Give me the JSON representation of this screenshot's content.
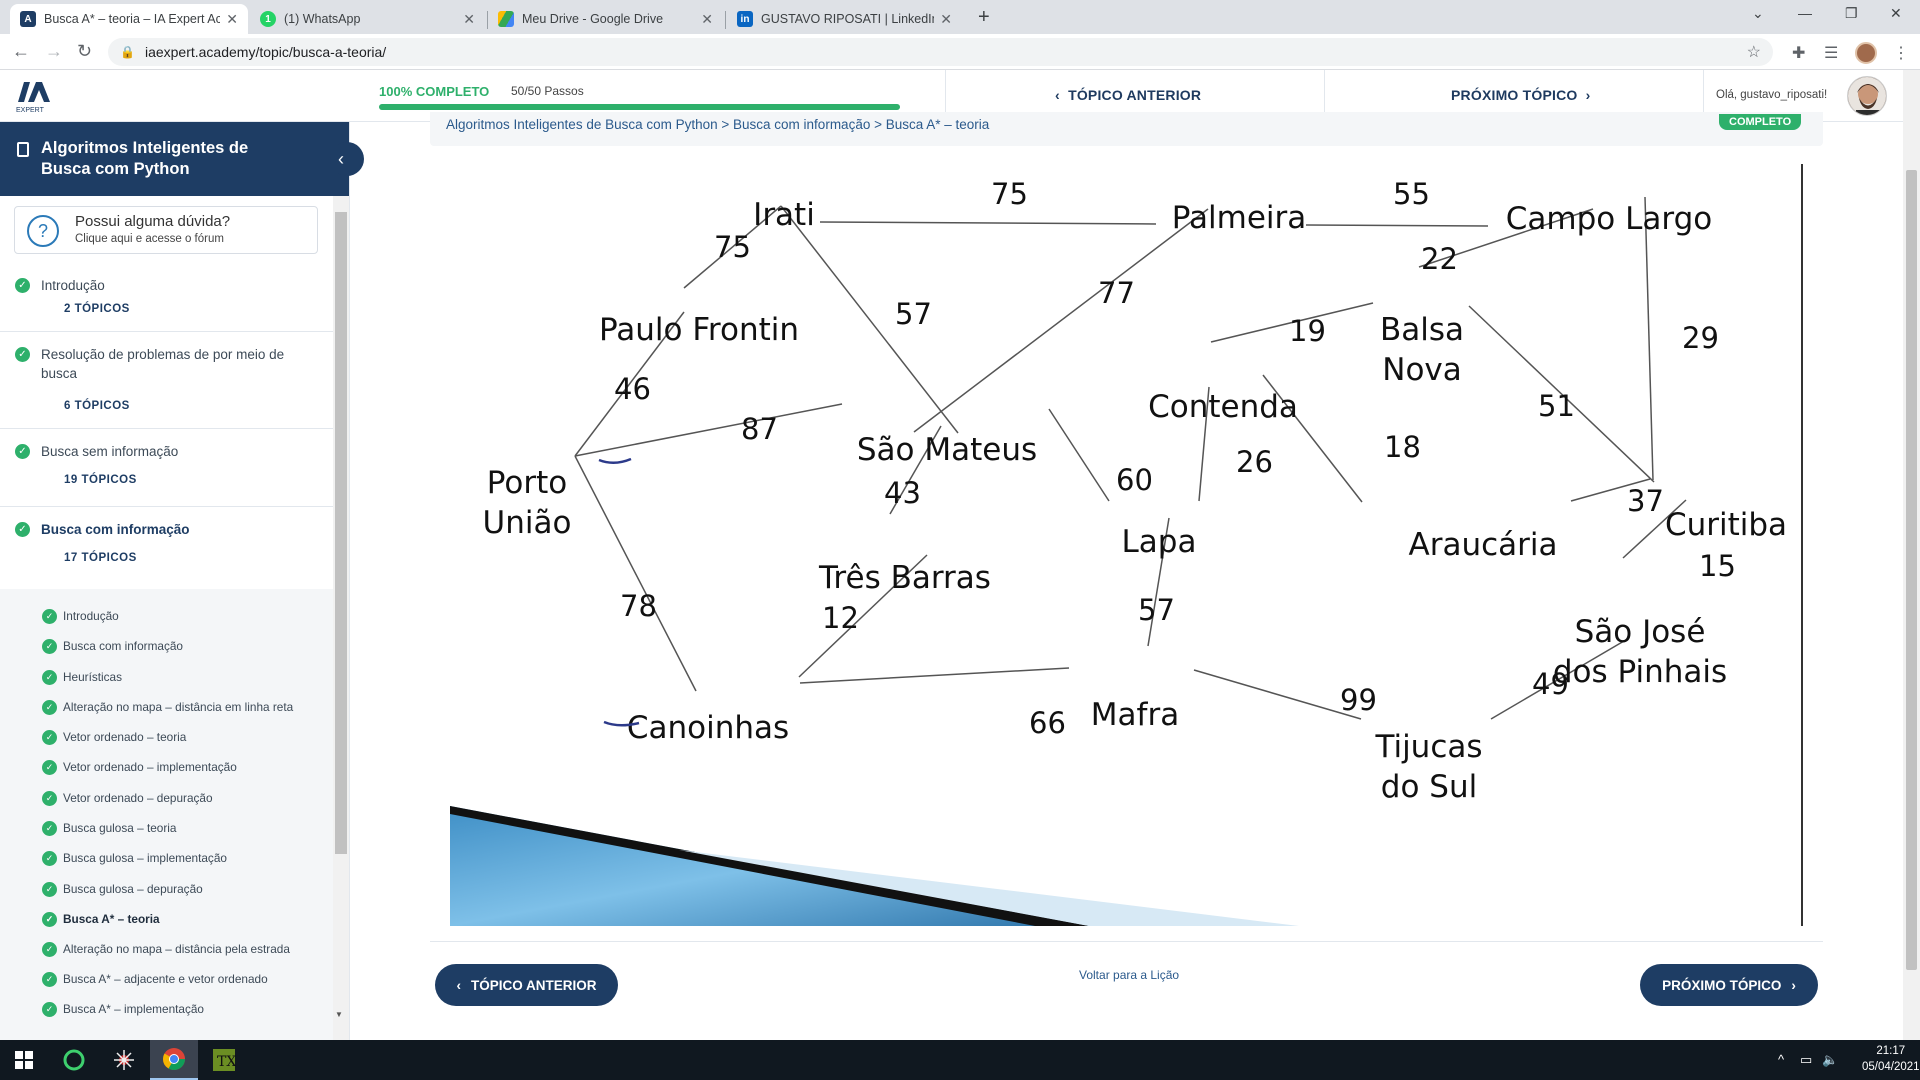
{
  "browser": {
    "tabs": [
      {
        "title": "Busca A* – teoria – IA Expert Aca",
        "active": true,
        "icon": "ia-expert-icon"
      },
      {
        "title": "(1) WhatsApp",
        "active": false,
        "icon": "whatsapp-icon"
      },
      {
        "title": "Meu Drive - Google Drive",
        "active": false,
        "icon": "google-drive-icon"
      },
      {
        "title": "GUSTAVO RIPOSATI | LinkedIn",
        "active": false,
        "icon": "linkedin-icon"
      }
    ],
    "url": "iaexpert.academy/topic/busca-a-teoria/"
  },
  "header": {
    "logo_text": "EXPERT",
    "progress_label": "100% COMPLETO",
    "progress_steps": "50/50 Passos",
    "progress_percent": 100,
    "prev_topic": "TÓPICO ANTERIOR",
    "next_topic": "PRÓXIMO TÓPICO",
    "greeting": "Olá, gustavo_riposati!"
  },
  "sidebar": {
    "course_title": "Algoritmos Inteligentes de Busca com Python",
    "forum_title": "Possui alguma dúvida?",
    "forum_subtitle": "Clique aqui e acesse o fórum",
    "lessons": [
      {
        "title": "Introdução",
        "count": "2 TÓPICOS"
      },
      {
        "title": "Resolução de problemas de por meio de busca",
        "count": "6 TÓPICOS"
      },
      {
        "title": "Busca sem informação",
        "count": "19 TÓPICOS"
      },
      {
        "title": "Busca com informação",
        "count": "17 TÓPICOS"
      }
    ],
    "topics": [
      "Introdução",
      "Busca com informação",
      "Heurísticas",
      "Alteração no mapa – distância em linha reta",
      "Vetor ordenado – teoria",
      "Vetor ordenado – implementação",
      "Vetor ordenado – depuração",
      "Busca gulosa – teoria",
      "Busca gulosa – implementação",
      "Busca gulosa – depuração",
      "Busca A* – teoria",
      "Alteração no mapa – distância pela estrada",
      "Busca A* – adjacente e vetor ordenado",
      "Busca A* – implementação"
    ]
  },
  "content": {
    "breadcrumb": "Algoritmos Inteligentes de Busca com Python > Busca com informação > Busca A* – teoria",
    "status_badge": "COMPLETO",
    "prev_button": "TÓPICO ANTERIOR",
    "next_button": "PRÓXIMO TÓPICO",
    "back_link": "Voltar para a Lição"
  },
  "map": {
    "cities": [
      "Irati",
      "Palmeira",
      "Campo Largo",
      "Paulo Frontin",
      "Balsa Nova",
      "Contenda",
      "São Mateus",
      "Porto União",
      "Lapa",
      "Araucária",
      "Curitiba",
      "Três Barras",
      "São José dos Pinhais",
      "Canoinhas",
      "Mafra",
      "Tijucas do Sul"
    ],
    "roads": [
      {
        "from": "Irati",
        "to": "Palmeira",
        "km": "75"
      },
      {
        "from": "Palmeira",
        "to": "Campo Largo",
        "km": "55"
      },
      {
        "from": "Irati",
        "to": "Paulo Frontin",
        "km": "75"
      },
      {
        "from": "Irati",
        "to": "São Mateus",
        "km": "57"
      },
      {
        "from": "Palmeira",
        "to": "São Mateus",
        "km": "77"
      },
      {
        "from": "Campo Largo",
        "to": "Balsa Nova",
        "km": "22"
      },
      {
        "from": "Campo Largo",
        "to": "Curitiba",
        "km": "29"
      },
      {
        "from": "Balsa Nova",
        "to": "Contenda",
        "km": "19"
      },
      {
        "from": "Balsa Nova",
        "to": "Curitiba",
        "km": "51"
      },
      {
        "from": "Paulo Frontin",
        "to": "Porto União",
        "km": "46"
      },
      {
        "from": "Porto União",
        "to": "São Mateus",
        "km": "87"
      },
      {
        "from": "Porto União",
        "to": "Canoinhas",
        "km": "78"
      },
      {
        "from": "São Mateus",
        "to": "Três Barras",
        "km": "43"
      },
      {
        "from": "São Mateus",
        "to": "Lapa",
        "km": "60"
      },
      {
        "from": "Contenda",
        "to": "Lapa",
        "km": "26"
      },
      {
        "from": "Contenda",
        "to": "Araucária",
        "km": "18"
      },
      {
        "from": "Araucária",
        "to": "Curitiba",
        "km": "37"
      },
      {
        "from": "Curitiba",
        "to": "São José dos Pinhais",
        "km": "15"
      },
      {
        "from": "Três Barras",
        "to": "Canoinhas",
        "km": "12"
      },
      {
        "from": "Lapa",
        "to": "Mafra",
        "km": "57"
      },
      {
        "from": "Canoinhas",
        "to": "Mafra",
        "km": "66"
      },
      {
        "from": "Mafra",
        "to": "Tijucas do Sul",
        "km": "99"
      },
      {
        "from": "São José dos Pinhais",
        "to": "Tijucas do Sul",
        "km": "49"
      }
    ]
  },
  "taskbar": {
    "time": "21:17",
    "date": "05/04/2021"
  },
  "colors": {
    "navy": "#1e3d64",
    "green": "#2eb06b"
  }
}
